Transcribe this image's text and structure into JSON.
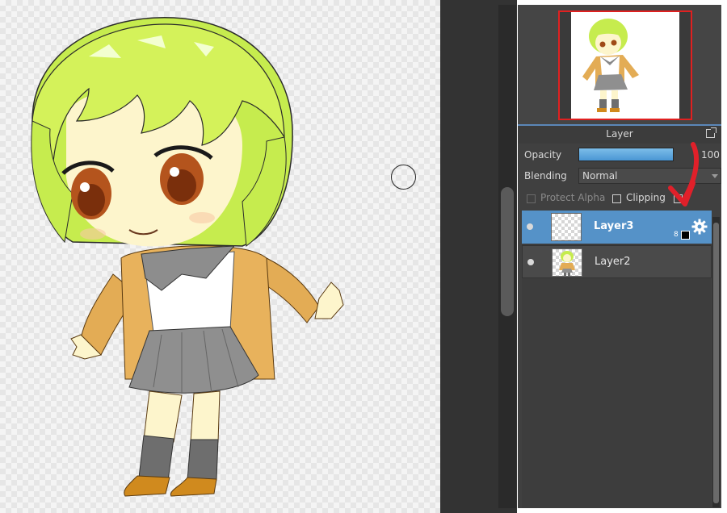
{
  "layer_panel": {
    "title": "Layer",
    "opacity_label": "Opacity",
    "opacity_value": "100",
    "opacity_fraction": 1.0,
    "blending_label": "Blending",
    "blending_value": "Normal",
    "protect_alpha_label": "Protect Alpha",
    "clipping_label": "Clipping",
    "layers": [
      {
        "name": "Layer3",
        "selected": true,
        "brush_size": "8"
      },
      {
        "name": "Layer2",
        "selected": false
      }
    ]
  },
  "colors": {
    "selected_layer": "#5592c8",
    "opacity_fill": "#4a96d4",
    "annotation_arrow": "#e0202a",
    "navigator_border": "#e02020",
    "panel_bg": "#404040"
  },
  "icons": [
    "eye-icon",
    "gear-icon",
    "popout-icon",
    "brush-cursor",
    "annotation-arrow"
  ]
}
